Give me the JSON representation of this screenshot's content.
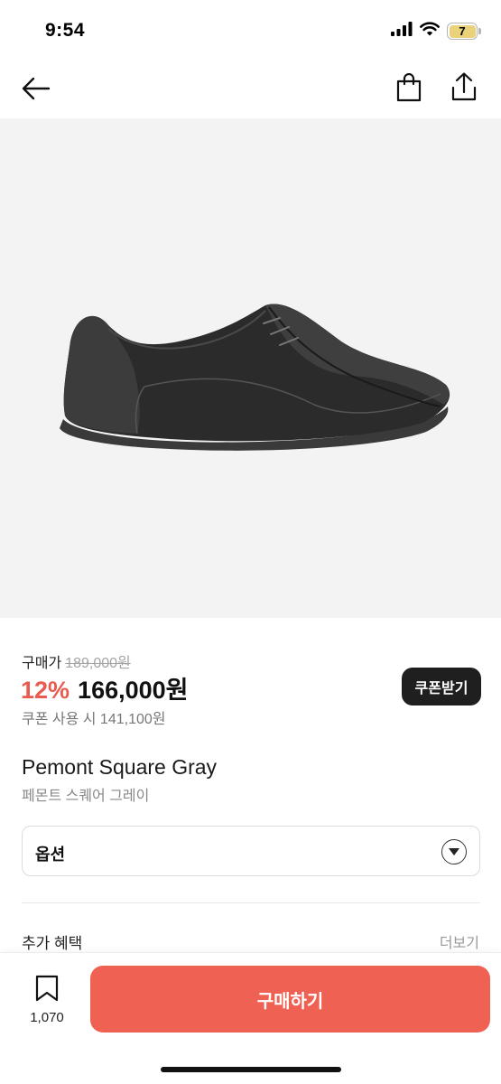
{
  "status_bar": {
    "time": "9:54",
    "battery": "7",
    "icons": [
      "signal-icon",
      "wifi-icon",
      "battery-icon"
    ]
  },
  "nav": {
    "icons": [
      "arrow-left-icon",
      "shopping-bag-icon",
      "share-icon"
    ]
  },
  "product": {
    "image_icon": "shoe-image",
    "price_label": "구매가",
    "original_price": "189,000원",
    "discount": "12%",
    "sale_price": "166,000원",
    "coupon_price": "쿠폰 사용 시 141,100원",
    "coupon_button": "쿠폰받기",
    "name": "Pemont Square Gray",
    "name_ko": "페몬트 스퀘어 그레이"
  },
  "option": {
    "label": "옵션"
  },
  "benefits": {
    "title": "추가 혜택",
    "more": "더보기"
  },
  "bottom_bar": {
    "bookmark_count": "1,070",
    "buy_label": "구매하기"
  },
  "colors": {
    "accent": "#ef6253",
    "discount": "#ea5a4e",
    "dark_button": "#1f1f1f"
  }
}
